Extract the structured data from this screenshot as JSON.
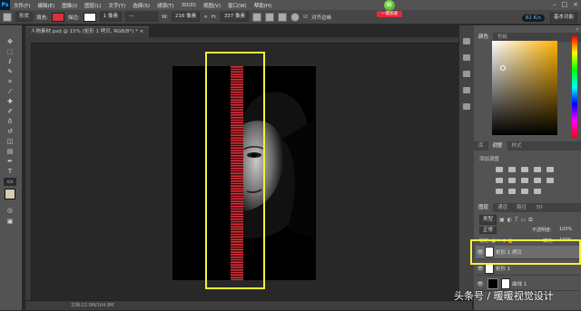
{
  "app": {
    "logo": "Ps"
  },
  "menu": [
    "文件(F)",
    "编辑(E)",
    "图像(I)",
    "图层(L)",
    "文字(Y)",
    "选择(S)",
    "滤镜(T)",
    "3D(D)",
    "视图(V)",
    "窗口(W)",
    "帮助(H)"
  ],
  "window_controls": [
    "–",
    "□",
    "×"
  ],
  "options": {
    "mode": "形状",
    "fill_label": "填充:",
    "stroke_label": "描边:",
    "stroke_width": "1 像素",
    "width_label": "W:",
    "width_value": "216 像素",
    "height_label": "H:",
    "height_value": "337 像素",
    "align_edges": "对齐边缘",
    "fill_color": "#d9333f"
  },
  "badge": {
    "number": "91",
    "label": "一键加速"
  },
  "workspace": {
    "speed": "82 K/s",
    "label": "基本功能"
  },
  "document": {
    "tab_title": "人物素材.psd @ 15% (矩形 1 拷贝, RGB/8*) *",
    "status": "文档:22.0M/164.8M"
  },
  "panels": {
    "color_tabs": [
      "颜色",
      "色板"
    ],
    "adjust_tabs": [
      "库",
      "调整",
      "样式"
    ],
    "adjust_title": "添加调整",
    "layer_tabs": [
      "图层",
      "通道",
      "路径",
      "3D"
    ],
    "layer_filter": "类型",
    "blend_mode": "正常",
    "opacity_label": "不透明度:",
    "opacity_value": "100%",
    "lock_label": "锁定:",
    "fill_label": "填充:",
    "fill_value": "100%"
  },
  "layers": [
    {
      "name": "矩形 1 拷贝",
      "selected": true
    },
    {
      "name": "矩形 1",
      "selected": false
    },
    {
      "name": "曲线 1",
      "selected": false
    }
  ],
  "watermark": "头条号 / 暖暖视觉设计",
  "colors": {
    "accent_highlight": "#f5f038",
    "stripe_red": "#d6313a"
  }
}
